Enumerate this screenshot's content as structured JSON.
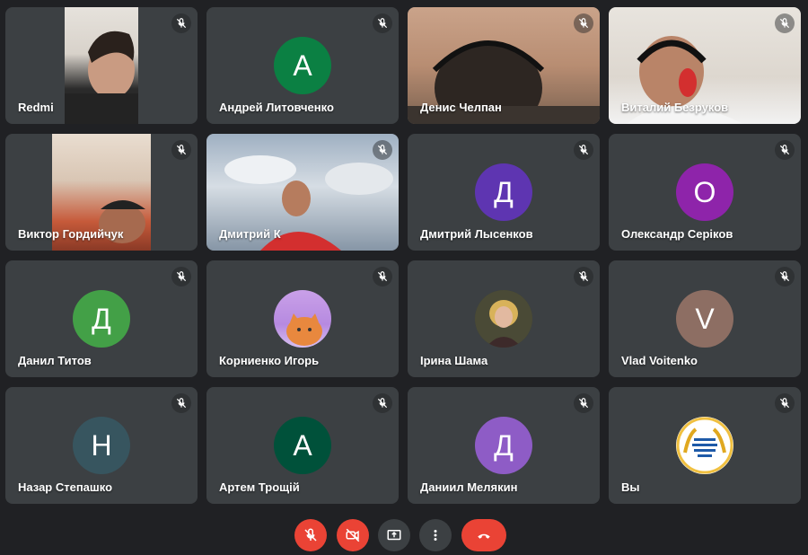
{
  "participants": [
    {
      "name": "Redmi",
      "type": "video"
    },
    {
      "name": "Андрей Литовченко",
      "type": "avatar",
      "initial": "А",
      "color": "#0b8043"
    },
    {
      "name": "Денис Челпан",
      "type": "video"
    },
    {
      "name": "Виталий Безруков",
      "type": "video"
    },
    {
      "name": "Виктор Гордийчук",
      "type": "video"
    },
    {
      "name": "Дмитрий К",
      "type": "video"
    },
    {
      "name": "Дмитрий Лысенков",
      "type": "avatar",
      "initial": "Д",
      "color": "#5e35b1"
    },
    {
      "name": "Олександр Серіков",
      "type": "avatar",
      "initial": "О",
      "color": "#8e24aa"
    },
    {
      "name": "Данил Титов",
      "type": "avatar",
      "initial": "Д",
      "color": "#43a047"
    },
    {
      "name": "Корниенко Игорь",
      "type": "photo-avatar"
    },
    {
      "name": "Ірина Шама",
      "type": "photo-avatar"
    },
    {
      "name": "Vlad Voitenko",
      "type": "avatar",
      "initial": "V",
      "color": "#8d6e63"
    },
    {
      "name": "Назар Степашко",
      "type": "avatar",
      "initial": "Н",
      "color": "#37555f"
    },
    {
      "name": "Артем Трощій",
      "type": "avatar",
      "initial": "А",
      "color": "#00513a"
    },
    {
      "name": "Даниил Мелякин",
      "type": "avatar",
      "initial": "Д",
      "color": "#8e5cc6"
    },
    {
      "name": "Вы",
      "type": "logo-avatar"
    }
  ],
  "controls": {
    "mic_icon": "mic-off-icon",
    "camera_icon": "camera-off-icon",
    "present_icon": "present-icon",
    "more_icon": "more-vert-icon",
    "hangup_icon": "hang-up-icon",
    "off_color": "#ea4335",
    "neutral_color": "#3c4043"
  }
}
